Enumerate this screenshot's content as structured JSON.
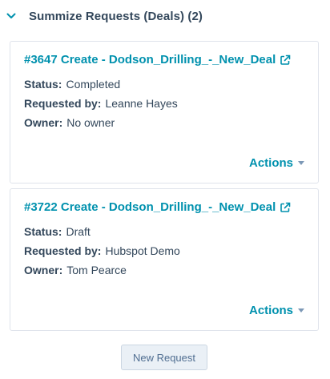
{
  "header": {
    "title": "Summize Requests (Deals) (2)",
    "icon": "chevron-down-icon"
  },
  "labels": {
    "status": "Status:",
    "requested_by": "Requested by:",
    "owner": "Owner:"
  },
  "requests": [
    {
      "title": "#3647 Create - Dodson_Drilling_-_New_Deal",
      "status": "Completed",
      "requested_by": "Leanne Hayes",
      "owner": "No owner",
      "actions_label": "Actions"
    },
    {
      "title": "#3722 Create - Dodson_Drilling_-_New_Deal",
      "status": "Draft",
      "requested_by": "Hubspot Demo",
      "owner": "Tom Pearce",
      "actions_label": "Actions"
    }
  ],
  "new_request_label": "New Request",
  "colors": {
    "link": "#0091ae",
    "text": "#33475b",
    "border": "#dfe3eb",
    "button_bg": "#eaf0f6"
  }
}
